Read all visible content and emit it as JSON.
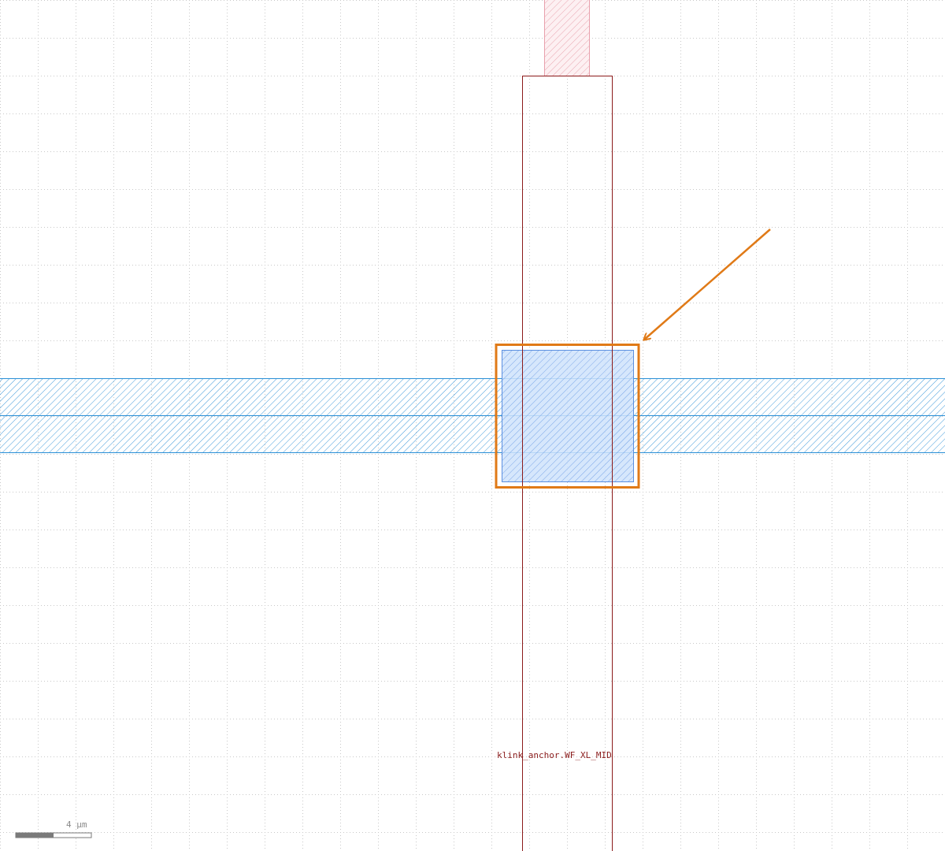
{
  "canvas": {
    "background": "#ffffff",
    "grid_color": "#c8c8c8",
    "grid_style": "dotted"
  },
  "cell": {
    "label": "klink_anchor.WF_XL_MID",
    "outline_color": "#8b1a1a"
  },
  "layers": {
    "waveguide_color": "#2a8fd6",
    "pad_fill": "#cfe3fb",
    "pad_hatch": "#5b8fe0",
    "upper_stub_color": "#e8a0ac"
  },
  "annotation": {
    "highlight_color": "#e07a17",
    "arrow_color": "#e07a17"
  },
  "scale_bar": {
    "label": "4 µm"
  }
}
